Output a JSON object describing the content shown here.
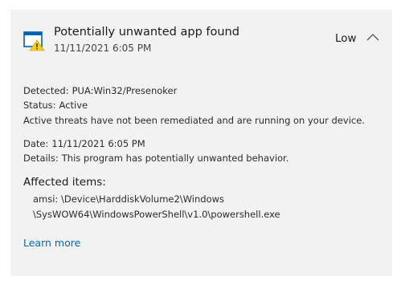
{
  "threat": {
    "title": "Potentially unwanted app found",
    "timestamp": "11/11/2021 6:05 PM",
    "severity": "Low",
    "icon": "window-warning-icon",
    "expand_icon": "chevron-up-icon"
  },
  "details": {
    "detected_label": "Detected:",
    "detected_value": "PUA:Win32/Presenoker",
    "status_label": "Status:",
    "status_value": "Active",
    "status_message": "Active threats have not been remediated and are running on your device.",
    "date_label": "Date:",
    "date_value": "11/11/2021 6:05 PM",
    "details_label": "Details:",
    "details_value": "This program has potentially unwanted behavior."
  },
  "affected": {
    "title": "Affected items:",
    "path_line1": "amsi: \\Device\\HarddiskVolume2\\Windows",
    "path_line2": "\\SysWOW64\\WindowsPowerShell\\v1.0\\powershell.exe"
  },
  "actions": {
    "learn_more": "Learn more"
  },
  "colors": {
    "card_bg": "#f2f2f2",
    "link": "#0067c0",
    "warning": "#fcd116",
    "icon_blue": "#0063b1"
  }
}
